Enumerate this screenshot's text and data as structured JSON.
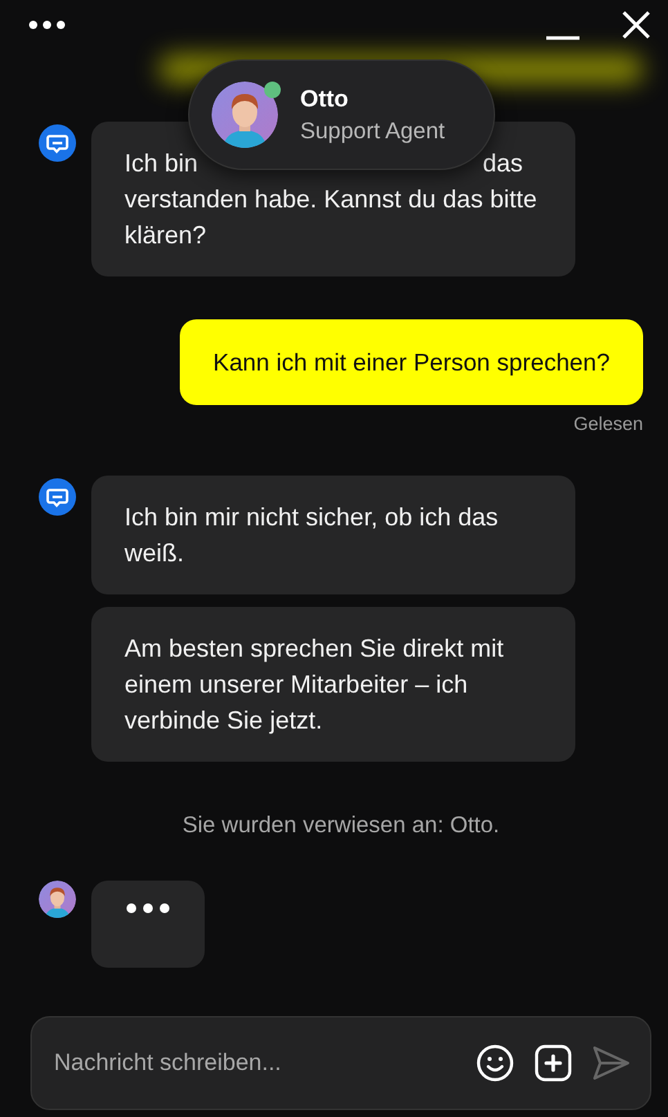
{
  "agent_card": {
    "name": "Otto",
    "role": "Support Agent",
    "online": true
  },
  "messages": [
    {
      "kind": "bot",
      "bubbles": [
        {
          "segments": [
            "Ich bin",
            "das",
            "verstanden habe. Kannst du das bitte klären?"
          ]
        }
      ]
    },
    {
      "kind": "user",
      "text": "Kann ich mit einer Person sprechen?",
      "status": "Gelesen"
    },
    {
      "kind": "bot",
      "bubbles": [
        {
          "segments": [
            "Ich bin mir nicht sicher, ob ich das weiß."
          ]
        },
        {
          "segments": [
            "Am besten sprechen Sie direkt mit einem unserer Mitarbeiter – ich verbinde Sie jetzt."
          ]
        }
      ]
    },
    {
      "kind": "system",
      "text": "Sie wurden verwiesen an: Otto."
    },
    {
      "kind": "typing"
    }
  ],
  "composer": {
    "placeholder": "Nachricht schreiben..."
  }
}
